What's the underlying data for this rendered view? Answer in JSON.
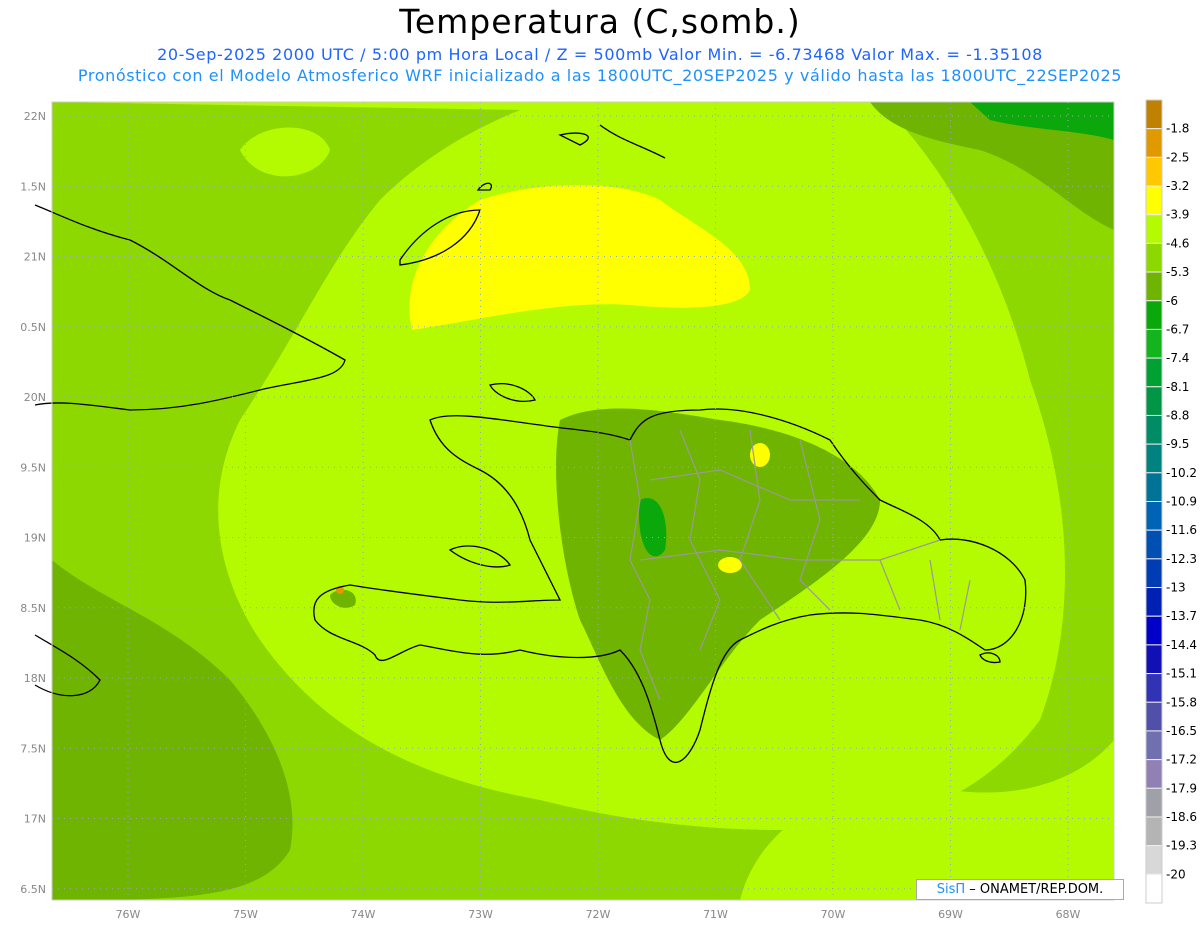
{
  "title": "Temperatura (C,somb.)",
  "subtitle1": "20-Sep-2025  2000 UTC / 5:00 pm Hora Local / Z = 500mb  Valor Min. = -6.73468  Valor Max. = -1.35108",
  "subtitle2": "Pronóstico con el Modelo Atmosferico WRF inicializado a las 1800UTC_20SEP2025 y válido hasta las  1800UTC_22SEP2025",
  "axes": {
    "lat_labels": [
      "22N",
      "1.5N",
      "21N",
      "0.5N",
      "20N",
      "9.5N",
      "19N",
      "8.5N",
      "18N",
      "7.5N",
      "17N",
      "6.5N"
    ],
    "lat_values": [
      22,
      21.5,
      21,
      20.5,
      20,
      19.5,
      19,
      18.5,
      18,
      17.5,
      17,
      16.5
    ],
    "lon_labels": [
      "76W",
      "75W",
      "74W",
      "73W",
      "72W",
      "71W",
      "70W",
      "69W",
      "68W"
    ],
    "lon_values": [
      -76,
      -75,
      -74,
      -73,
      -72,
      -71,
      -70,
      -69,
      -68
    ]
  },
  "colorbar": {
    "labels": [
      "-1.8",
      "-2.5",
      "-3.2",
      "-3.9",
      "-4.6",
      "-5.3",
      "-6",
      "-6.7",
      "-7.4",
      "-8.1",
      "-8.8",
      "-9.5",
      "-10.2",
      "-10.9",
      "-11.6",
      "-12.3",
      "-13",
      "-13.7",
      "-14.4",
      "-15.1",
      "-15.8",
      "-16.5",
      "-17.2",
      "-17.9",
      "-18.6",
      "-19.3",
      "-20"
    ],
    "colors": [
      "#c08000",
      "#e09a00",
      "#ffc800",
      "#ffff00",
      "#b4fa00",
      "#8cd800",
      "#6eb400",
      "#0aa80a",
      "#14b41e",
      "#00a032",
      "#009646",
      "#008c64",
      "#008280",
      "#007396",
      "#0064b4",
      "#0050b4",
      "#003cb4",
      "#0020b4",
      "#0000c8",
      "#1010b4",
      "#3232b4",
      "#5050aa",
      "#7070b0",
      "#9080b4",
      "#a0a0a8",
      "#b4b4b4",
      "#d8d8d8",
      "#ffffff"
    ]
  },
  "credit": {
    "brand": "SisΠ",
    "org": "– ONAMET/REP.DOM."
  }
}
